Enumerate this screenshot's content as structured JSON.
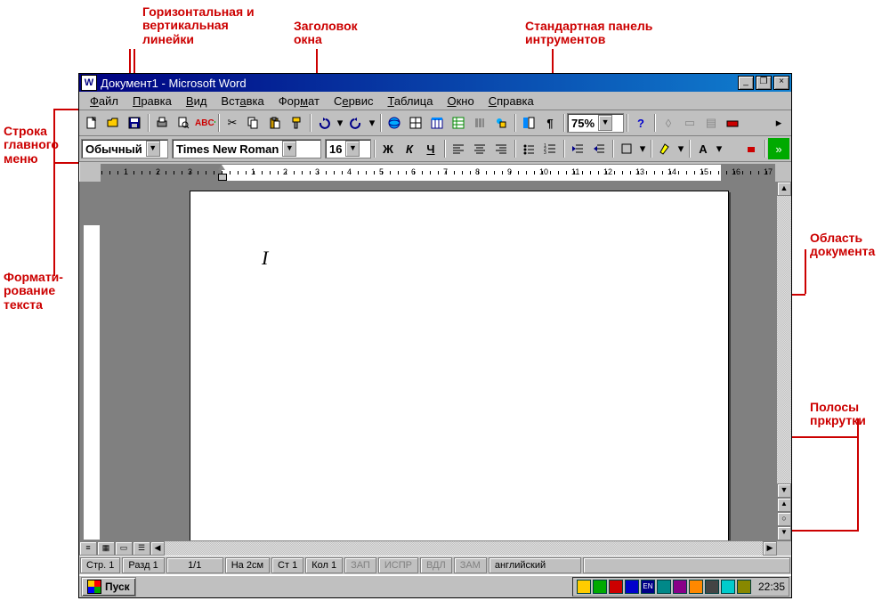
{
  "labels": {
    "rulers": "Горизонтальная и\nвертикальная\nлинейки",
    "title_ann": "Заголовок\nокна",
    "std_toolbar": "Стандартная панель\nинтрументов",
    "main_menu": "Строка\nглавного\nменю",
    "formatting": "Формати-\nрование\nтекста",
    "doc_area": "Область\nдокумента",
    "scrollbars": "Полосы\nпркрутки"
  },
  "title": "Документ1 - Microsoft Word",
  "menu": [
    "Файл",
    "Правка",
    "Вид",
    "Вставка",
    "Формат",
    "Сервис",
    "Таблица",
    "Окно",
    "Справка"
  ],
  "toolbar_icons": [
    "new",
    "open",
    "save",
    "sep",
    "print",
    "preview",
    "spell",
    "sep",
    "cut",
    "copy",
    "paste",
    "format-painter",
    "sep",
    "undo",
    "redo",
    "sep",
    "hyperlink",
    "tables",
    "insert-table",
    "excel",
    "columns",
    "drawing",
    "sep",
    "doc-map",
    "para",
    "sep"
  ],
  "zoom": "75%",
  "style": "Обычный",
  "font": "Times New Roman",
  "size": "16",
  "format_icons": [
    "bold",
    "italic",
    "underline",
    "sep",
    "align-left",
    "align-center",
    "align-right",
    "sep",
    "bullets",
    "numbering",
    "sep",
    "outdent",
    "indent",
    "sep",
    "borders",
    "sep",
    "highlight",
    "sep",
    "font-color"
  ],
  "ruler_left_nums": [
    "3",
    "2",
    "1"
  ],
  "ruler_right_nums": [
    "1",
    "2",
    "3",
    "4",
    "5",
    "6",
    "7",
    "8",
    "9",
    "10",
    "11",
    "12",
    "13",
    "14",
    "15",
    "16",
    "17"
  ],
  "status": {
    "page": "Стр. 1",
    "section": "Разд 1",
    "pages": "1/1",
    "at": "На 2см",
    "line": "Ст 1",
    "col": "Кол 1",
    "rec": "ЗАП",
    "trk": "ИСПР",
    "ext": "ВДЛ",
    "ovr": "ЗАМ",
    "lang": "английский"
  },
  "taskbar": {
    "start": "Пуск",
    "lang_ind": "EN",
    "clock": "22:35"
  },
  "format_btn_text": {
    "bold": "Ж",
    "italic": "К",
    "underline": "Ч"
  }
}
